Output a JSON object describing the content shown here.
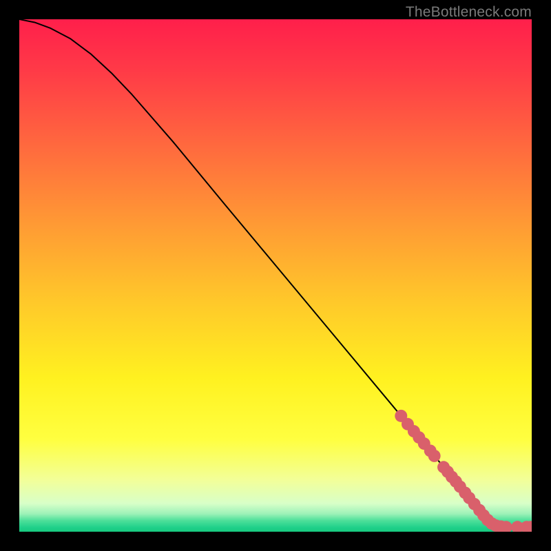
{
  "watermark": "TheBottleneck.com",
  "chart_data": {
    "type": "line",
    "title": "",
    "xlabel": "",
    "ylabel": "",
    "xlim": [
      0,
      100
    ],
    "ylim": [
      0,
      100
    ],
    "grid": false,
    "series": [
      {
        "name": "curve",
        "x": [
          0,
          3,
          6,
          10,
          14,
          18,
          22,
          30,
          40,
          50,
          60,
          70,
          75,
          78,
          80,
          82,
          84,
          86,
          88,
          90,
          92,
          94,
          96,
          98,
          100
        ],
        "y": [
          100,
          99.4,
          98.3,
          96.2,
          93.2,
          89.5,
          85.3,
          76.1,
          64.0,
          52.0,
          40.0,
          28.0,
          22.0,
          18.4,
          16.0,
          13.6,
          11.2,
          8.8,
          6.4,
          4.0,
          2.1,
          1.1,
          0.9,
          0.9,
          0.9
        ],
        "stroke": "#000000",
        "stroke_width": 2
      }
    ],
    "markers": [
      {
        "name": "dots",
        "color": "#d9606b",
        "radius": 9,
        "points": [
          {
            "x": 74.5,
            "y": 22.6
          },
          {
            "x": 75.8,
            "y": 21.0
          },
          {
            "x": 77.0,
            "y": 19.6
          },
          {
            "x": 78.0,
            "y": 18.4
          },
          {
            "x": 79.0,
            "y": 17.2
          },
          {
            "x": 80.2,
            "y": 15.8
          },
          {
            "x": 81.0,
            "y": 14.8
          },
          {
            "x": 82.8,
            "y": 12.6
          },
          {
            "x": 83.6,
            "y": 11.7
          },
          {
            "x": 84.4,
            "y": 10.7
          },
          {
            "x": 85.2,
            "y": 9.8
          },
          {
            "x": 86.0,
            "y": 8.8
          },
          {
            "x": 87.0,
            "y": 7.6
          },
          {
            "x": 87.8,
            "y": 6.6
          },
          {
            "x": 88.8,
            "y": 5.4
          },
          {
            "x": 89.8,
            "y": 4.2
          },
          {
            "x": 90.6,
            "y": 3.2
          },
          {
            "x": 91.4,
            "y": 2.3
          },
          {
            "x": 92.2,
            "y": 1.6
          },
          {
            "x": 93.0,
            "y": 1.2
          },
          {
            "x": 94.0,
            "y": 1.0
          },
          {
            "x": 95.0,
            "y": 0.9
          },
          {
            "x": 97.2,
            "y": 0.9
          },
          {
            "x": 99.0,
            "y": 0.9
          },
          {
            "x": 99.8,
            "y": 0.9
          }
        ]
      }
    ],
    "background_gradient": {
      "stops": [
        {
          "offset": 0.0,
          "color": "#ff1f4b"
        },
        {
          "offset": 0.1,
          "color": "#ff3a47"
        },
        {
          "offset": 0.25,
          "color": "#ff6a3e"
        },
        {
          "offset": 0.4,
          "color": "#ff9a34"
        },
        {
          "offset": 0.55,
          "color": "#ffc82a"
        },
        {
          "offset": 0.7,
          "color": "#fff120"
        },
        {
          "offset": 0.82,
          "color": "#ffff40"
        },
        {
          "offset": 0.9,
          "color": "#f2ff9a"
        },
        {
          "offset": 0.945,
          "color": "#d8ffc8"
        },
        {
          "offset": 0.965,
          "color": "#9df2b8"
        },
        {
          "offset": 0.978,
          "color": "#4fe09a"
        },
        {
          "offset": 0.992,
          "color": "#1fd08a"
        },
        {
          "offset": 1.0,
          "color": "#18c97f"
        }
      ]
    }
  }
}
